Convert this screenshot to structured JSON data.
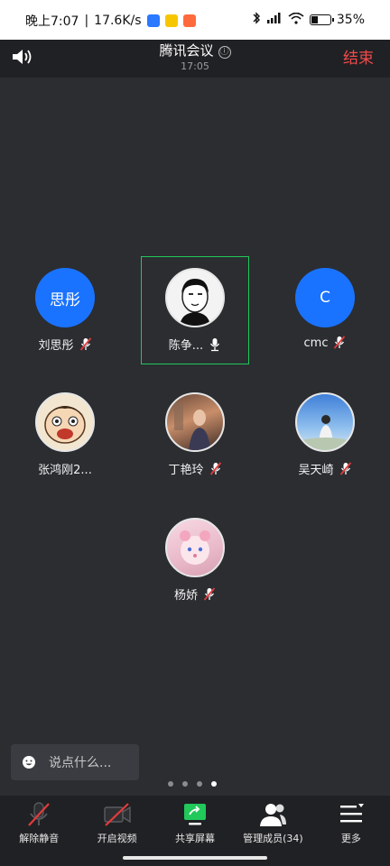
{
  "status_bar": {
    "time": "晚上7:07",
    "net_speed": "17.6K/s",
    "battery": "35%",
    "battery_level": 0.35,
    "app_icon_colors": [
      "#2a79ff",
      "#f6c700",
      "#ff6a3d"
    ]
  },
  "header": {
    "title": "腾讯会议",
    "info_icon": "ⓘ",
    "duration": "17:05",
    "end_label": "结束",
    "end_color": "#f24b4b"
  },
  "participants": [
    {
      "avatar_text": "思彤",
      "name": "刘思彤",
      "muted": true
    },
    {
      "avatar_text": "",
      "name": "陈争...",
      "muted": false,
      "speaking": true
    },
    {
      "avatar_text": "C",
      "name": "cmc",
      "muted": true
    },
    {
      "avatar_text": "",
      "name": "张鸿刚2...",
      "muted": false
    },
    {
      "avatar_text": "",
      "name": "丁艳玲",
      "muted": true
    },
    {
      "avatar_text": "",
      "name": "吴天崎",
      "muted": true
    },
    {
      "avatar_text": "",
      "name": "杨娇",
      "muted": true
    }
  ],
  "chat": {
    "placeholder": "说点什么..."
  },
  "pagination": {
    "page_count": 4,
    "current_page": 4
  },
  "toolbar": {
    "unmute": "解除静音",
    "start_video": "开启视频",
    "share_screen": "共享屏幕",
    "manage_members": "管理成员(34)",
    "more": "更多"
  },
  "colors": {
    "accent_blue": "#1a73ff",
    "speaking_border": "#21c85a",
    "mute_red": "#e23b3b",
    "share_green": "#21c85a"
  }
}
